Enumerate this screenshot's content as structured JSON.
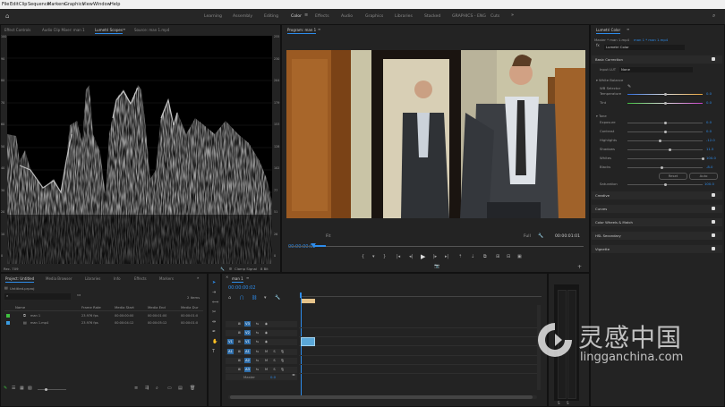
{
  "menu": [
    "File",
    "Edit",
    "Clip",
    "Sequence",
    "Markers",
    "Graphics",
    "View",
    "Window",
    "Help"
  ],
  "workspaces": {
    "items": [
      "Learning",
      "Assembly",
      "Editing",
      "Color",
      "Effects",
      "Audio",
      "Graphics",
      "Libraries",
      "Stacked",
      "GRAPHICS - ENG",
      "Cuts"
    ],
    "active": "Color"
  },
  "scopes_panel": {
    "tabs": [
      "Effect Controls",
      "Audio Clip Mixer: man 1",
      "Lumetri Scopes",
      "Source: man 1.mp4"
    ],
    "active_tab": "Lumetri Scopes",
    "y_ticks": [
      "100",
      "90",
      "80",
      "70",
      "60",
      "50",
      "40",
      "30",
      "20",
      "10",
      "0"
    ],
    "y_ticks_right": [
      "255",
      "230",
      "204",
      "179",
      "153",
      "128",
      "102",
      "77",
      "51",
      "26",
      "0"
    ],
    "footer_left": "Rec. 709",
    "footer_clamp": "Clamp Signal",
    "footer_bit": "8 Bit"
  },
  "program_monitor": {
    "tab": "Program: man 1",
    "timecode_current": "00:00:00:02",
    "fit": "Fit",
    "quality": "Full",
    "timecode_duration": "00:00:01:01"
  },
  "lumetri_color": {
    "tab": "Lumetri Color",
    "master_path": "Master * man 1.mp4",
    "clip_path": "man 1 * man 1.mp4",
    "effect_name": "Lumetri Color",
    "sections": {
      "basic": "Basic Correction",
      "input_lut_label": "Input LUT",
      "input_lut_value": "None",
      "white_balance": "White Balance",
      "wb_selector": "WB Selector",
      "tone": "Tone",
      "reset": "Reset",
      "auto": "Auto"
    },
    "controls": [
      {
        "label": "Temperature",
        "value": "0.0",
        "level": 0.5
      },
      {
        "label": "Tint",
        "value": "0.0",
        "level": 0.5
      },
      {
        "label": "Exposure",
        "value": "0.0",
        "level": 0.5
      },
      {
        "label": "Contrast",
        "value": "0.0",
        "level": 0.5
      },
      {
        "label": "Highlights",
        "value": "-12.0",
        "level": 0.44
      },
      {
        "label": "Shadows",
        "value": "11.5",
        "level": 0.56
      },
      {
        "label": "Whites",
        "value": "100.0",
        "level": 1.0
      },
      {
        "label": "Blacks",
        "value": "-8.0",
        "level": 0.46
      }
    ],
    "saturation": {
      "label": "Saturation",
      "value": "100.0",
      "level": 0.5
    },
    "collapsed_sections": [
      "Creative",
      "Curves",
      "Color Wheels & Match",
      "HSL Secondary",
      "Vignette"
    ]
  },
  "project_panel": {
    "tabs": [
      "Project: Untitled",
      "Media Browser",
      "Libraries",
      "Info",
      "Effects",
      "Markers"
    ],
    "active_tab": "Project: Untitled",
    "project_file": "Untitled.prproj",
    "item_count": "2 items",
    "columns": [
      "Name",
      "Frame Rate",
      "Media Start",
      "Media End",
      "Media Dur"
    ],
    "rows": [
      {
        "name": "man 1",
        "frame_rate": "23.976 fps",
        "start": "00:00:00:00",
        "end": "00:00:01:00",
        "dur": "00:00:01:0",
        "color": "#3fbf3f"
      },
      {
        "name": "man 1.mp4",
        "frame_rate": "23.976 fps",
        "start": "00:00:04:12",
        "end": "00:00:05:12",
        "dur": "00:00:01:0",
        "color": "#3a9be0"
      }
    ]
  },
  "timeline": {
    "tab": "man 1",
    "timecode": "00:00:00:02",
    "video_tracks": [
      "V3",
      "V2",
      "V1"
    ],
    "audio_tracks": [
      "A1",
      "A2",
      "A3"
    ],
    "master_label": "Master",
    "master_value": "0.0",
    "source_v": "V1",
    "source_a": "A1"
  },
  "watermark": {
    "brand_cn": "灵感中国",
    "brand_en": "lingganchina.com"
  }
}
